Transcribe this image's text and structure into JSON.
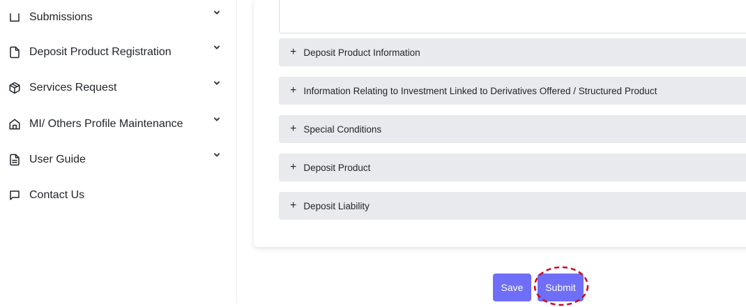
{
  "sidebar": {
    "items": [
      {
        "label": "Submissions",
        "icon": "square-icon",
        "has_chevron": true
      },
      {
        "label": "Deposit Product Registration",
        "icon": "file-icon",
        "has_chevron": true
      },
      {
        "label": "Services Request",
        "icon": "package-icon",
        "has_chevron": true
      },
      {
        "label": "MI/ Others Profile Maintenance",
        "icon": "home-icon",
        "has_chevron": true
      },
      {
        "label": "User Guide",
        "icon": "file-text-icon",
        "has_chevron": true
      },
      {
        "label": "Contact Us",
        "icon": "message-square-icon",
        "has_chevron": false
      }
    ]
  },
  "main": {
    "accordions": [
      {
        "label": "Deposit Product Information"
      },
      {
        "label": "Information Relating to Investment Linked to Derivatives Offered / Structured Product"
      },
      {
        "label": "Special Conditions"
      },
      {
        "label": "Deposit Product"
      },
      {
        "label": "Deposit Liability"
      }
    ],
    "plus_symbol": "+"
  },
  "actions": {
    "save_label": "Save",
    "submit_label": "Submit"
  },
  "colors": {
    "primary_button": "#6f6ef6",
    "accordion_bg": "#e8eaed",
    "highlight_ring": "#d0021b"
  }
}
